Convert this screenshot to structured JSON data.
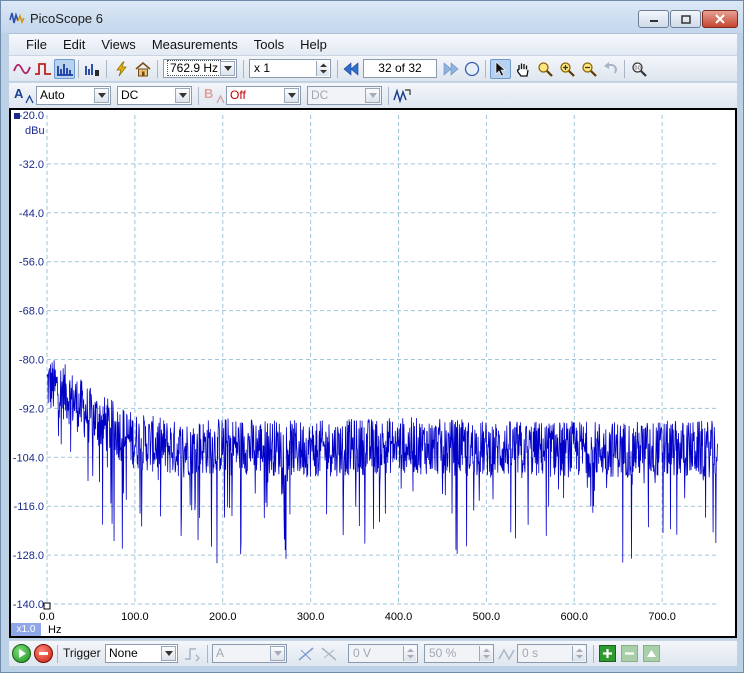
{
  "window": {
    "title": "PicoScope 6"
  },
  "menu": [
    "File",
    "Edit",
    "Views",
    "Measurements",
    "Tools",
    "Help"
  ],
  "toolbar": {
    "timebase": "762.9 Hz",
    "multiplier": "x 1",
    "buffer_current": "32",
    "buffer_sep": "of",
    "buffer_total": "32"
  },
  "channels": {
    "a_label": "A",
    "a_range": "Auto",
    "a_coupling": "DC",
    "b_label": "B",
    "b_range": "Off",
    "b_coupling": "DC"
  },
  "trigger": {
    "label": "Trigger",
    "mode": "None",
    "source": "A",
    "threshold": "0 V",
    "pretrigger": "50 %",
    "delay": "0 s"
  },
  "colors": {
    "trace": "#0000c8",
    "grid": "#9fc6d8",
    "axis_text": "#1a2a8c",
    "axis_text_x": "#000000"
  },
  "chart_data": {
    "type": "line",
    "y_unit": "dBu",
    "x_unit": "Hz",
    "zoom_badge": "x1.0",
    "ylim": [
      -140.0,
      -20.0
    ],
    "xlim": [
      0.0,
      762.9
    ],
    "y_ticks": [
      "-20.0",
      "-32.0",
      "-44.0",
      "-56.0",
      "-68.0",
      "-80.0",
      "-92.0",
      "-104.0",
      "-116.0",
      "-128.0",
      "-140.0"
    ],
    "x_ticks": [
      "0.0",
      "100.0",
      "200.0",
      "300.0",
      "400.0",
      "500.0",
      "600.0",
      "700.0"
    ],
    "grid": true,
    "series": [
      {
        "trend": [
          [
            0,
            -86
          ],
          [
            20,
            -88
          ],
          [
            50,
            -94
          ],
          [
            100,
            -100
          ],
          [
            150,
            -102
          ],
          [
            200,
            -101
          ],
          [
            300,
            -102
          ],
          [
            400,
            -101
          ],
          [
            500,
            -102
          ],
          [
            600,
            -102
          ],
          [
            700,
            -102
          ],
          [
            762.9,
            -102
          ]
        ],
        "spread_dB": 7
      }
    ]
  }
}
